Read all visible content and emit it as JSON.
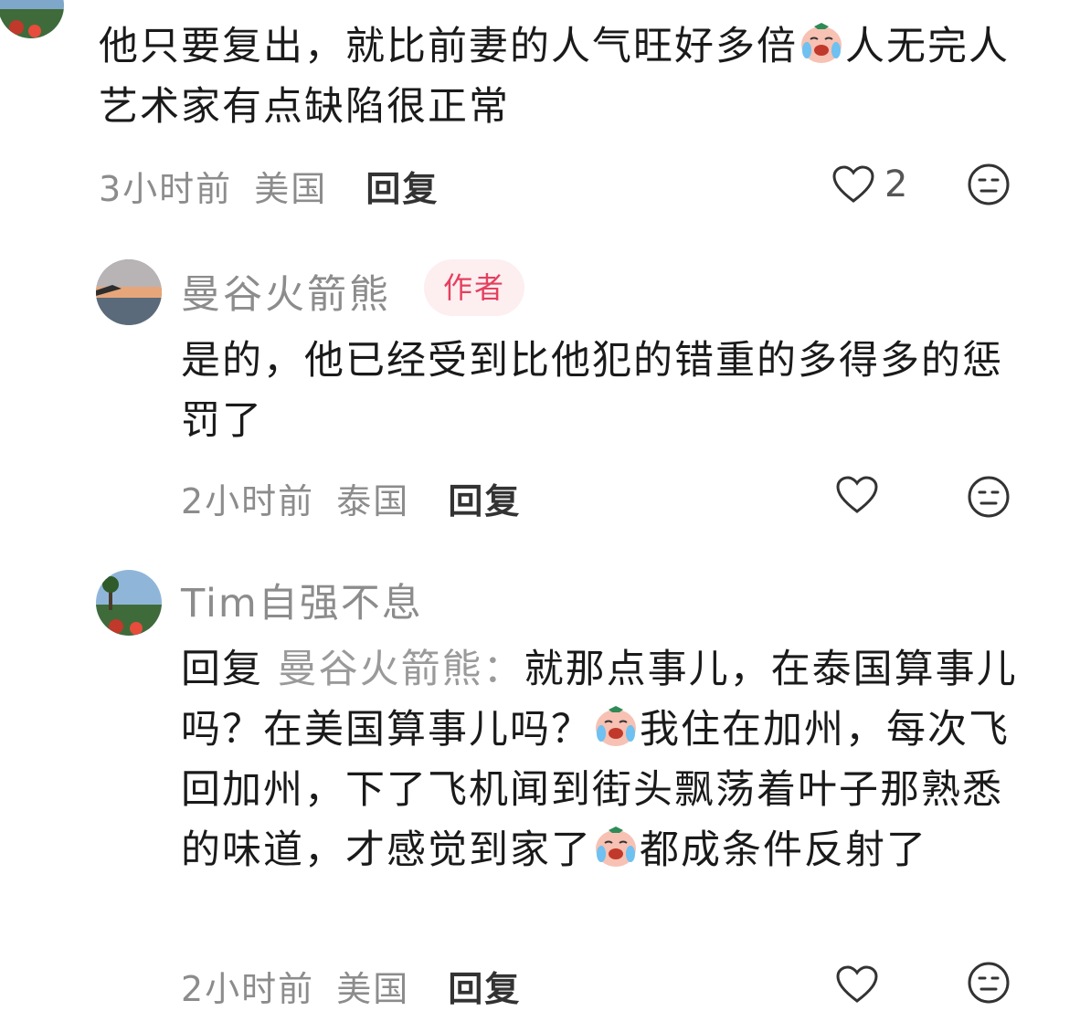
{
  "comment1": {
    "text_a": "他只要复出，就比前妻的人气旺好多倍",
    "text_b": "人无完人 艺术家有点缺陷很正常",
    "time": "3小时前",
    "location": "美国",
    "reply_label": "回复",
    "likes": "2",
    "emoji": "crying-laughing-emoji"
  },
  "comment2": {
    "username": "曼谷火箭熊",
    "author_badge": "作者",
    "text": "是的，他已经受到比他犯的错重的多得多的惩罚了",
    "time": "2小时前",
    "location": "泰国",
    "reply_label": "回复"
  },
  "comment3": {
    "username": "Tim自强不息",
    "reply_prefix": "回复",
    "reply_to": "曼谷火箭熊：",
    "text_a": "就那点事儿，在泰国算事儿吗？在美国算事儿吗？",
    "text_b": "我住在加州，每次飞回加州，下了飞机闻到街头飘荡着叶子那熟悉的味道，才感觉到家了",
    "text_c": "都成条件反射了",
    "time": "2小时前",
    "location": "美国",
    "reply_label": "回复"
  },
  "icons": [
    "heart-outline-icon",
    "neutral-face-icon",
    "crying-laughing-emoji"
  ]
}
